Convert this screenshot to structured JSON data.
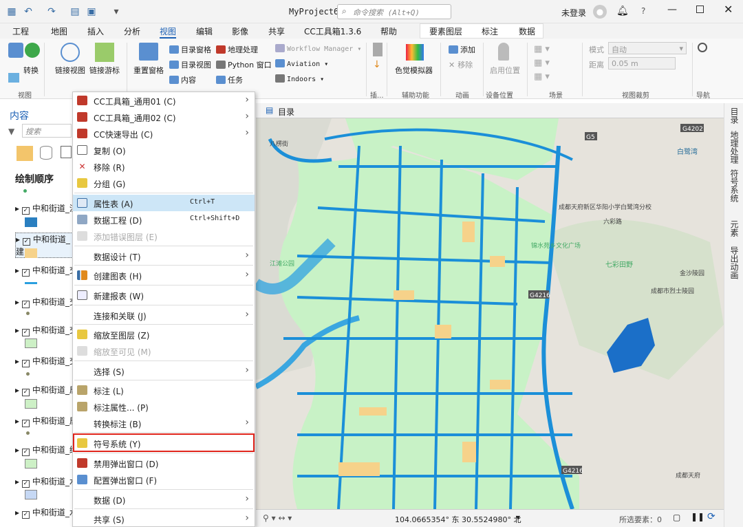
{
  "titlebar": {
    "project": "MyProject6",
    "search_placeholder": "命令搜索 (Alt+Q)",
    "user": "未登录"
  },
  "menu_tabs": [
    "工程",
    "地图",
    "插入",
    "分析",
    "视图",
    "编辑",
    "影像",
    "共享",
    "CC工具箱1.3.6",
    "帮助",
    "要素图层",
    "标注",
    "数据"
  ],
  "ribbon": {
    "convert": "转换",
    "link_views": "链接视图",
    "link_navigation": "链接游标",
    "reset_panes": "重置窗格",
    "catalog_pane": "目录窗格",
    "catalog_view": "目录视图",
    "contents": "内容",
    "geoprocessing": "地理处理",
    "python_window": "Python 窗口",
    "tasks": "任务",
    "workflow_manager": "Workflow Manager",
    "aviation": "Aviation",
    "indoors": "Indoors",
    "color_vision": "色觉模拟器",
    "add": "添加",
    "remove": "移除",
    "device_location": "启用位置",
    "mode_label": "模式",
    "mode_value": "自动",
    "distance_label": "距离",
    "distance_value": "0.05  m",
    "groups": {
      "view": "视图",
      "accessibility": "辅助功能",
      "animation": "动画",
      "device_location": "设备位置",
      "scene": "场景",
      "view_cropping": "视图裁剪",
      "navigation": "导航",
      "windows": "窗口",
      "link": "链接",
      "extra": "插..."
    }
  },
  "contents": {
    "title": "内容",
    "search_placeholder": "搜索",
    "drawing_order": "绘制顺序",
    "layers": [
      "中和街道_流",
      "中和街道_建",
      "中和街道_交",
      "中和街道_交",
      "中和街道_交",
      "中和街道_交",
      "中和街道_居",
      "中和街道_居",
      "中和街道_绿",
      "中和街道_水",
      "中和街道_水"
    ]
  },
  "map": {
    "tab": "目录",
    "coords": "104.0665354° 东  30.5524980° 北",
    "selected": "所选要素：0",
    "labels": [
      "八楞街",
      "白鹭湾",
      "六彩路",
      "七彩田野",
      "金沙陵园",
      "成都市烈士陵园",
      "锦水苑乡文化广场",
      "江滩公园",
      "成都天府",
      "成都天府新区华阳小学白鹭湾分校"
    ],
    "road_codes": [
      "G4202",
      "G5",
      "D216",
      "G4216",
      "G4216",
      "S2"
    ]
  },
  "right_tabs": [
    "目录",
    "地理处理",
    "符号系统",
    "元素",
    "导出动画"
  ],
  "context_menu": {
    "items": [
      {
        "label": "CC工具箱_通用01 (C)",
        "arrow": true
      },
      {
        "label": "CC工具箱_通用02 (C)",
        "arrow": true
      },
      {
        "label": "CC快速导出 (C)",
        "arrow": true
      },
      {
        "label": "复制 (O)"
      },
      {
        "label": "移除 (R)"
      },
      {
        "label": "分组 (G)"
      },
      {
        "label": "属性表 (A)",
        "shortcut": "Ctrl+T"
      },
      {
        "label": "数据工程 (D)",
        "shortcut": "Ctrl+Shift+D"
      },
      {
        "label": "添加错误图层 (E)"
      },
      {
        "label": "数据设计 (T)",
        "arrow": true
      },
      {
        "label": "创建图表 (H)",
        "arrow": true
      },
      {
        "label": "新建报表 (W)"
      },
      {
        "label": "连接和关联 (J)",
        "arrow": true
      },
      {
        "label": "缩放至图层 (Z)"
      },
      {
        "label": "缩放至可见 (M)"
      },
      {
        "label": "选择 (S)",
        "arrow": true
      },
      {
        "label": "标注 (L)"
      },
      {
        "label": "标注属性... (P)"
      },
      {
        "label": "转换标注 (B)",
        "arrow": true
      },
      {
        "label": "符号系统 (Y)"
      },
      {
        "label": "禁用弹出窗口 (D)"
      },
      {
        "label": "配置弹出窗口 (F)"
      },
      {
        "label": "数据 (D)",
        "arrow": true
      },
      {
        "label": "共享 (S)",
        "arrow": true
      }
    ]
  }
}
